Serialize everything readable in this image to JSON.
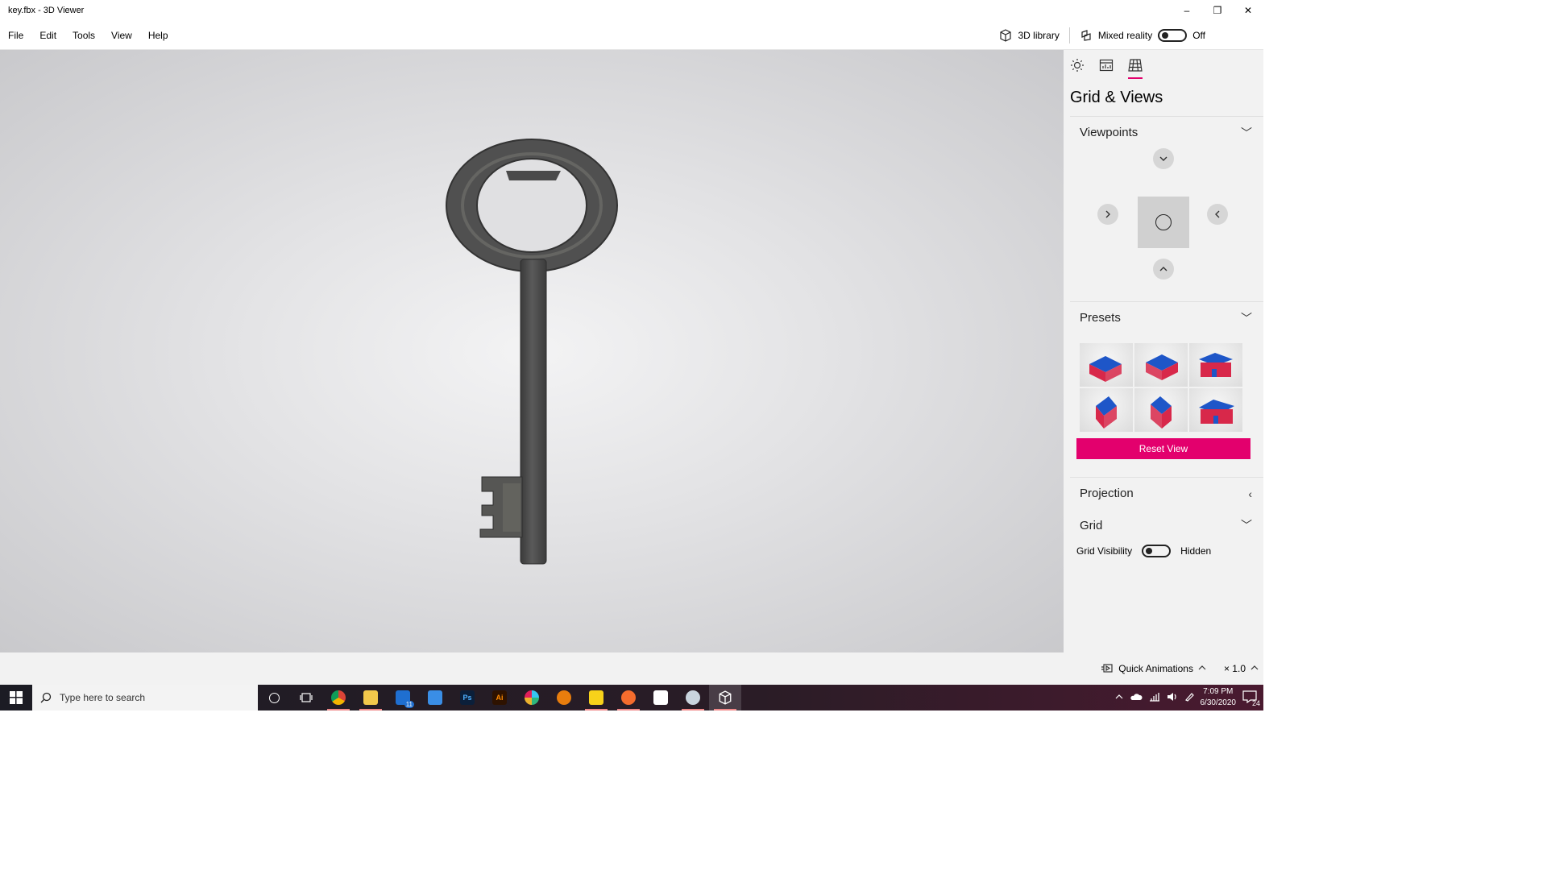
{
  "window": {
    "title": "key.fbx - 3D Viewer",
    "minimize": "–",
    "maximize": "❐",
    "close": "✕"
  },
  "menu": {
    "items": [
      "File",
      "Edit",
      "Tools",
      "View",
      "Help"
    ],
    "library_label": "3D library",
    "mixed_reality_label": "Mixed reality",
    "mixed_reality_state": "Off"
  },
  "panel": {
    "title": "Grid & Views",
    "tabs": [
      "lighting-icon",
      "stats-icon",
      "grid-icon"
    ],
    "active_tab": "grid-icon",
    "viewpoints": {
      "label": "Viewpoints",
      "chevron": "﹀"
    },
    "presets": {
      "label": "Presets",
      "chevron": "﹀",
      "count": 6
    },
    "reset_label": "Reset View",
    "projection": {
      "label": "Projection",
      "chevron": "‹"
    },
    "grid": {
      "label": "Grid",
      "chevron": "﹀",
      "visibility_label": "Grid Visibility",
      "visibility_state": "Hidden"
    }
  },
  "status": {
    "quick_animations": "Quick Animations",
    "speed": "× 1.0"
  },
  "taskbar": {
    "search_placeholder": "Type here to search",
    "mail_badge": "11",
    "time": "7:09 PM",
    "date": "6/30/2020",
    "notification_count": "24"
  },
  "colors": {
    "accent": "#e3006d",
    "key_metal": "#4a4a4a",
    "house_roof": "#1e56c8",
    "house_wall": "#d8284a"
  }
}
